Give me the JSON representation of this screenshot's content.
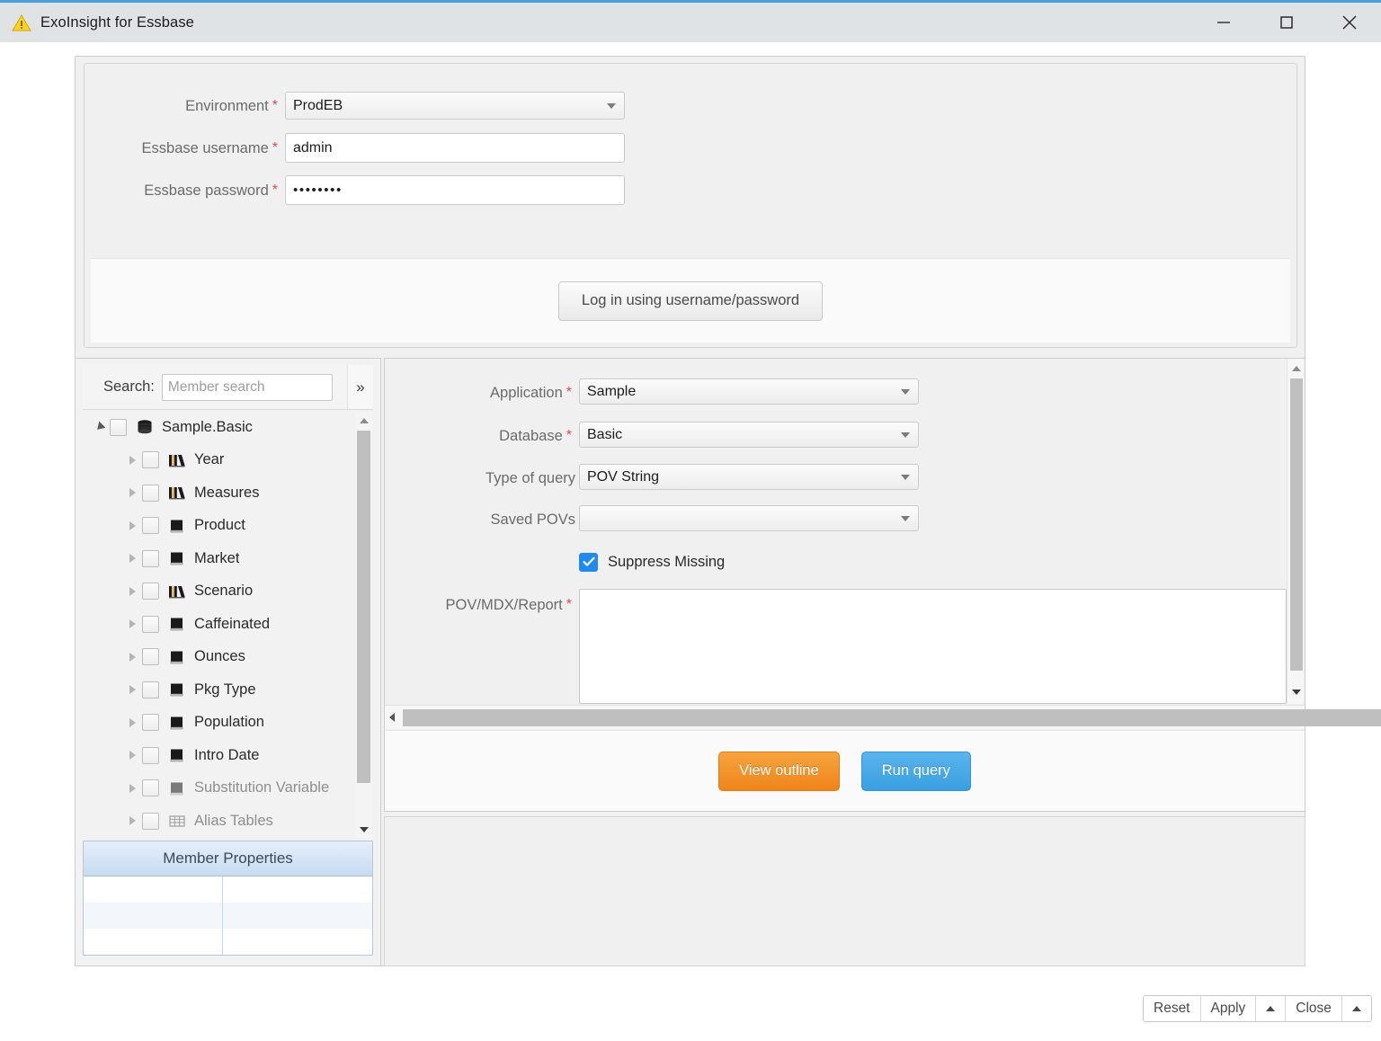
{
  "window": {
    "title": "ExoInsight for Essbase",
    "icon": "warning-triangle-icon",
    "controls": {
      "minimize": "minimize-icon",
      "maximize": "maximize-icon",
      "close": "close-icon"
    },
    "accent": "#4a9eda"
  },
  "login": {
    "environment": {
      "label": "Environment",
      "required": "*",
      "value": "ProdEB"
    },
    "username": {
      "label": "Essbase username",
      "required": "*",
      "value": "admin"
    },
    "password": {
      "label": "Essbase password",
      "required": "*",
      "value": "••••••••"
    },
    "login_button": "Log in using username/password"
  },
  "tree": {
    "search_label": "Search:",
    "search_value": "",
    "search_placeholder": "Member search",
    "expand_icon": "»",
    "root": {
      "label": "Sample.Basic",
      "icon": "database-icon",
      "arrow": "expanded"
    },
    "items": [
      {
        "label": "Year",
        "icon": "sparse-dimension-icon",
        "arrow": "collapsed",
        "dim": false
      },
      {
        "label": "Measures",
        "icon": "sparse-dimension-icon",
        "arrow": "collapsed",
        "dim": false
      },
      {
        "label": "Product",
        "icon": "dense-dimension-icon",
        "arrow": "collapsed",
        "dim": false
      },
      {
        "label": "Market",
        "icon": "dense-dimension-icon",
        "arrow": "collapsed",
        "dim": false
      },
      {
        "label": "Scenario",
        "icon": "sparse-dimension-icon",
        "arrow": "collapsed",
        "dim": false
      },
      {
        "label": "Caffeinated",
        "icon": "dense-dimension-icon",
        "arrow": "collapsed",
        "dim": false
      },
      {
        "label": "Ounces",
        "icon": "dense-dimension-icon",
        "arrow": "collapsed",
        "dim": false
      },
      {
        "label": "Pkg Type",
        "icon": "dense-dimension-icon",
        "arrow": "collapsed",
        "dim": false
      },
      {
        "label": "Population",
        "icon": "dense-dimension-icon",
        "arrow": "collapsed",
        "dim": false
      },
      {
        "label": "Intro Date",
        "icon": "dense-dimension-icon",
        "arrow": "collapsed",
        "dim": false
      },
      {
        "label": "Substitution Variable",
        "icon": "dense-dimension-icon",
        "arrow": "collapsed",
        "dim": true
      },
      {
        "label": "Alias Tables",
        "icon": "table-grid-icon",
        "arrow": "collapsed",
        "dim": true
      }
    ]
  },
  "member_properties": {
    "header": "Member Properties",
    "rows": [
      {
        "name": "",
        "value": ""
      },
      {
        "name": "",
        "value": ""
      },
      {
        "name": "",
        "value": ""
      }
    ]
  },
  "query": {
    "application": {
      "label": "Application",
      "required": "*",
      "value": "Sample"
    },
    "database": {
      "label": "Database",
      "required": "*",
      "value": "Basic"
    },
    "type_of_query": {
      "label": "Type of query",
      "required": "",
      "value": "POV String"
    },
    "saved_povs": {
      "label": "Saved POVs",
      "required": "",
      "value": ""
    },
    "suppress_missing": {
      "label": "Suppress Missing",
      "checked": true
    },
    "pov_mdx_report": {
      "label": "POV/MDX/Report",
      "required": "*",
      "value": ""
    },
    "actions": {
      "view_outline": "View outline",
      "run_query": "Run query"
    },
    "colors": {
      "view_outline": "#f08519",
      "run_query": "#3a9fe0",
      "checkbox": "#1f8af0",
      "required": "#e24a4a"
    }
  },
  "footer": {
    "buttons": [
      {
        "label": "Reset",
        "kind": "text"
      },
      {
        "label": "Apply",
        "kind": "text"
      },
      {
        "label": "",
        "kind": "caret"
      },
      {
        "label": "Close",
        "kind": "text"
      },
      {
        "label": "",
        "kind": "caret"
      }
    ]
  }
}
